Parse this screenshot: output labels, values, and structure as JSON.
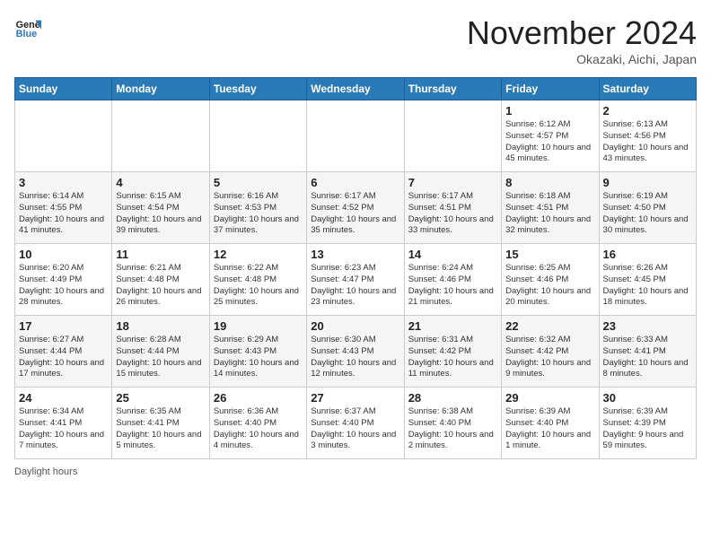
{
  "header": {
    "logo_line1": "General",
    "logo_line2": "Blue",
    "month_title": "November 2024",
    "location": "Okazaki, Aichi, Japan"
  },
  "columns": [
    "Sunday",
    "Monday",
    "Tuesday",
    "Wednesday",
    "Thursday",
    "Friday",
    "Saturday"
  ],
  "weeks": [
    [
      {
        "day": "",
        "info": ""
      },
      {
        "day": "",
        "info": ""
      },
      {
        "day": "",
        "info": ""
      },
      {
        "day": "",
        "info": ""
      },
      {
        "day": "",
        "info": ""
      },
      {
        "day": "1",
        "info": "Sunrise: 6:12 AM\nSunset: 4:57 PM\nDaylight: 10 hours and 45 minutes."
      },
      {
        "day": "2",
        "info": "Sunrise: 6:13 AM\nSunset: 4:56 PM\nDaylight: 10 hours and 43 minutes."
      }
    ],
    [
      {
        "day": "3",
        "info": "Sunrise: 6:14 AM\nSunset: 4:55 PM\nDaylight: 10 hours and 41 minutes."
      },
      {
        "day": "4",
        "info": "Sunrise: 6:15 AM\nSunset: 4:54 PM\nDaylight: 10 hours and 39 minutes."
      },
      {
        "day": "5",
        "info": "Sunrise: 6:16 AM\nSunset: 4:53 PM\nDaylight: 10 hours and 37 minutes."
      },
      {
        "day": "6",
        "info": "Sunrise: 6:17 AM\nSunset: 4:52 PM\nDaylight: 10 hours and 35 minutes."
      },
      {
        "day": "7",
        "info": "Sunrise: 6:17 AM\nSunset: 4:51 PM\nDaylight: 10 hours and 33 minutes."
      },
      {
        "day": "8",
        "info": "Sunrise: 6:18 AM\nSunset: 4:51 PM\nDaylight: 10 hours and 32 minutes."
      },
      {
        "day": "9",
        "info": "Sunrise: 6:19 AM\nSunset: 4:50 PM\nDaylight: 10 hours and 30 minutes."
      }
    ],
    [
      {
        "day": "10",
        "info": "Sunrise: 6:20 AM\nSunset: 4:49 PM\nDaylight: 10 hours and 28 minutes."
      },
      {
        "day": "11",
        "info": "Sunrise: 6:21 AM\nSunset: 4:48 PM\nDaylight: 10 hours and 26 minutes."
      },
      {
        "day": "12",
        "info": "Sunrise: 6:22 AM\nSunset: 4:48 PM\nDaylight: 10 hours and 25 minutes."
      },
      {
        "day": "13",
        "info": "Sunrise: 6:23 AM\nSunset: 4:47 PM\nDaylight: 10 hours and 23 minutes."
      },
      {
        "day": "14",
        "info": "Sunrise: 6:24 AM\nSunset: 4:46 PM\nDaylight: 10 hours and 21 minutes."
      },
      {
        "day": "15",
        "info": "Sunrise: 6:25 AM\nSunset: 4:46 PM\nDaylight: 10 hours and 20 minutes."
      },
      {
        "day": "16",
        "info": "Sunrise: 6:26 AM\nSunset: 4:45 PM\nDaylight: 10 hours and 18 minutes."
      }
    ],
    [
      {
        "day": "17",
        "info": "Sunrise: 6:27 AM\nSunset: 4:44 PM\nDaylight: 10 hours and 17 minutes."
      },
      {
        "day": "18",
        "info": "Sunrise: 6:28 AM\nSunset: 4:44 PM\nDaylight: 10 hours and 15 minutes."
      },
      {
        "day": "19",
        "info": "Sunrise: 6:29 AM\nSunset: 4:43 PM\nDaylight: 10 hours and 14 minutes."
      },
      {
        "day": "20",
        "info": "Sunrise: 6:30 AM\nSunset: 4:43 PM\nDaylight: 10 hours and 12 minutes."
      },
      {
        "day": "21",
        "info": "Sunrise: 6:31 AM\nSunset: 4:42 PM\nDaylight: 10 hours and 11 minutes."
      },
      {
        "day": "22",
        "info": "Sunrise: 6:32 AM\nSunset: 4:42 PM\nDaylight: 10 hours and 9 minutes."
      },
      {
        "day": "23",
        "info": "Sunrise: 6:33 AM\nSunset: 4:41 PM\nDaylight: 10 hours and 8 minutes."
      }
    ],
    [
      {
        "day": "24",
        "info": "Sunrise: 6:34 AM\nSunset: 4:41 PM\nDaylight: 10 hours and 7 minutes."
      },
      {
        "day": "25",
        "info": "Sunrise: 6:35 AM\nSunset: 4:41 PM\nDaylight: 10 hours and 5 minutes."
      },
      {
        "day": "26",
        "info": "Sunrise: 6:36 AM\nSunset: 4:40 PM\nDaylight: 10 hours and 4 minutes."
      },
      {
        "day": "27",
        "info": "Sunrise: 6:37 AM\nSunset: 4:40 PM\nDaylight: 10 hours and 3 minutes."
      },
      {
        "day": "28",
        "info": "Sunrise: 6:38 AM\nSunset: 4:40 PM\nDaylight: 10 hours and 2 minutes."
      },
      {
        "day": "29",
        "info": "Sunrise: 6:39 AM\nSunset: 4:40 PM\nDaylight: 10 hours and 1 minute."
      },
      {
        "day": "30",
        "info": "Sunrise: 6:39 AM\nSunset: 4:39 PM\nDaylight: 9 hours and 59 minutes."
      }
    ]
  ],
  "footer": "Daylight hours"
}
